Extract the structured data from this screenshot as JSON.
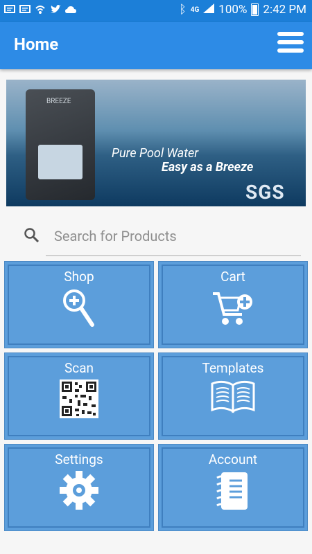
{
  "status_bar": {
    "battery": "100%",
    "time": "2:42 PM"
  },
  "app_bar": {
    "title": "Home"
  },
  "banner": {
    "line1": "Pure Pool Water",
    "line2": "Easy as a Breeze",
    "logo_text": "SGS",
    "device_label": "BREEZE"
  },
  "search": {
    "placeholder": "Search for Products"
  },
  "tiles": [
    {
      "label": "Shop",
      "icon": "magnifier-plus-icon"
    },
    {
      "label": "Cart",
      "icon": "cart-add-icon"
    },
    {
      "label": "Scan",
      "icon": "qr-code-icon"
    },
    {
      "label": "Templates",
      "icon": "book-icon"
    },
    {
      "label": "Settings",
      "icon": "gear-icon"
    },
    {
      "label": "Account",
      "icon": "notebook-icon"
    }
  ],
  "colors": {
    "primary": "#2d8be6",
    "status_bar": "#1c7fd8",
    "tile": "#5c9edb"
  }
}
